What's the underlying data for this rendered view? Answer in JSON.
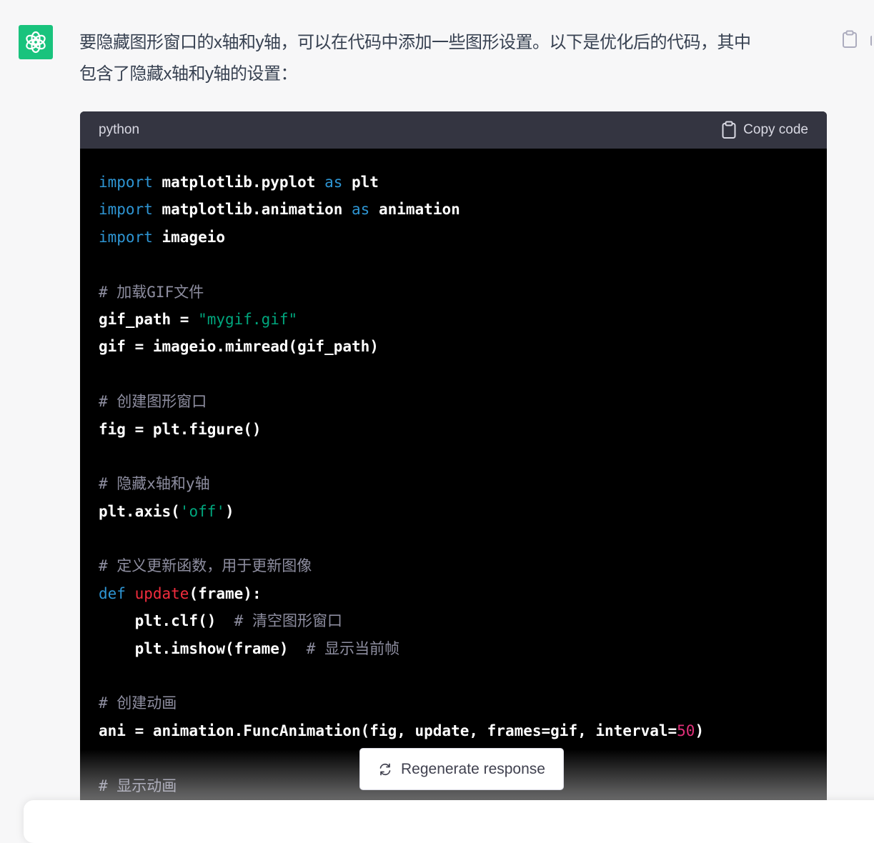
{
  "message": {
    "line1": "要隐藏图形窗口的x轴和y轴，可以在代码中添加一些图形设置。以下是优化后的代码，其中",
    "line2": "包含了隐藏x轴和y轴的设置："
  },
  "code_block": {
    "language": "python",
    "copy_label": "Copy code",
    "lines": {
      "l1": {
        "a": "import",
        "b": " matplotlib.pyplot ",
        "c": "as",
        "d": " plt"
      },
      "l2": {
        "a": "import",
        "b": " matplotlib.animation ",
        "c": "as",
        "d": " animation"
      },
      "l3": {
        "a": "import",
        "b": " imageio"
      },
      "l5": {
        "a": "# 加载GIF文件"
      },
      "l6": {
        "a": "gif_path = ",
        "b": "\"mygif.gif\""
      },
      "l7": {
        "a": "gif = imageio.mimread(gif_path)"
      },
      "l9": {
        "a": "# 创建图形窗口"
      },
      "l10": {
        "a": "fig = plt.figure()"
      },
      "l12": {
        "a": "# 隐藏x轴和y轴"
      },
      "l13": {
        "a": "plt.axis(",
        "b": "'off'",
        "c": ")"
      },
      "l15": {
        "a": "# 定义更新函数，用于更新图像"
      },
      "l16": {
        "a": "def",
        "b": " ",
        "c": "update",
        "d": "(frame):"
      },
      "l17": {
        "a": "    plt.clf()  ",
        "b": "# 清空图形窗口"
      },
      "l18": {
        "a": "    plt.imshow(frame)  ",
        "b": "# 显示当前帧"
      },
      "l20": {
        "a": "# 创建动画"
      },
      "l21": {
        "a": "ani = animation.FuncAnimation(fig, update, frames=gif, interval=",
        "b": "50",
        "c": ")"
      },
      "l23": {
        "a": "# 显示动画"
      }
    }
  },
  "regenerate_label": "Regenerate response",
  "icons": {
    "avatar": "openai-logo-icon",
    "side_copy": "clipboard-icon",
    "copy": "clipboard-icon",
    "regenerate": "refresh-icon"
  },
  "colors": {
    "avatar_bg": "#19c37d",
    "code_bg": "#000000",
    "code_header_bg": "#343541",
    "keyword": "#2e95d3",
    "string": "#00a67d",
    "comment": "#8e8ea0",
    "function": "#f22c3d",
    "number": "#df3079"
  }
}
